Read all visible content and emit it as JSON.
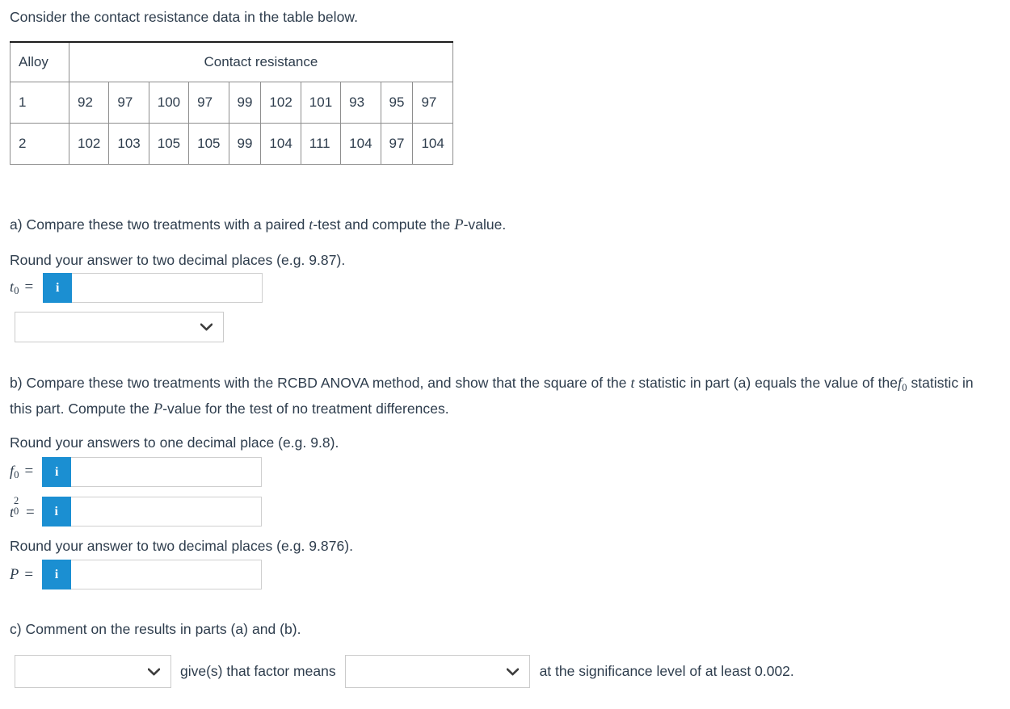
{
  "intro": {
    "text": "Consider the contact resistance data in the table below."
  },
  "table": {
    "header": {
      "alloy": "Alloy",
      "contact_resistance": "Contact resistance"
    },
    "rows": [
      {
        "alloy": "1",
        "values": [
          "92",
          "97",
          "100",
          "97",
          "99",
          "102",
          "101",
          "93",
          "95",
          "97"
        ]
      },
      {
        "alloy": "2",
        "values": [
          "102",
          "103",
          "105",
          "105",
          "99",
          "104",
          "111",
          "104",
          "97",
          "104"
        ]
      }
    ]
  },
  "part_a": {
    "prompt_1": "a) Compare these two treatments with a paired ",
    "prompt_t": "t",
    "prompt_2": "-test and compute the ",
    "prompt_P": "P",
    "prompt_3": "-value.",
    "rounding": "Round your answer to two decimal places (e.g. 9.87).",
    "t0_label": "t",
    "t0_sub": "0",
    "equals": "=",
    "info_icon": "info-icon",
    "input_value": "",
    "input_placeholder": "",
    "select_value": "",
    "chevron_icon": "chevron-down-icon"
  },
  "part_b": {
    "prompt_1": "b) Compare these two treatments with the RCBD ANOVA method, and show that the square of the ",
    "prompt_t": "t",
    "prompt_2": " statistic in part (a) equals the value of the",
    "prompt_f": "f",
    "prompt_f_sub": "0",
    "prompt_3": " statistic in this part. Compute the ",
    "prompt_P": "P",
    "prompt_4": "-value for the test of no treatment differences.",
    "rounding_1": "Round your answers to one decimal place (e.g. 9.8).",
    "rounding_2": "Round your answer to two decimal places (e.g. 9.876).",
    "f0_label": "f",
    "f0_sub": "0",
    "t0sq_label": "t",
    "t0sq_sup": "2",
    "t0sq_sub": "0",
    "P_label": "P",
    "equals": "=",
    "info_icon": "info-icon",
    "f0_value": "",
    "t0sq_value": "",
    "P_value": ""
  },
  "part_c": {
    "prompt": "c) Comment on the results in parts (a) and (b).",
    "select1_value": "",
    "middle_text": "give(s) that factor means",
    "select2_value": "",
    "end_text": "at the significance level of at least 0.002.",
    "chevron_icon": "chevron-down-icon"
  },
  "colors": {
    "info_button_blue": "#1b8fd2",
    "text": "#2e3d4d",
    "table_border": "#8e8e8e",
    "table_top_border": "#1c1c1c",
    "input_border": "#cfcfcf"
  }
}
